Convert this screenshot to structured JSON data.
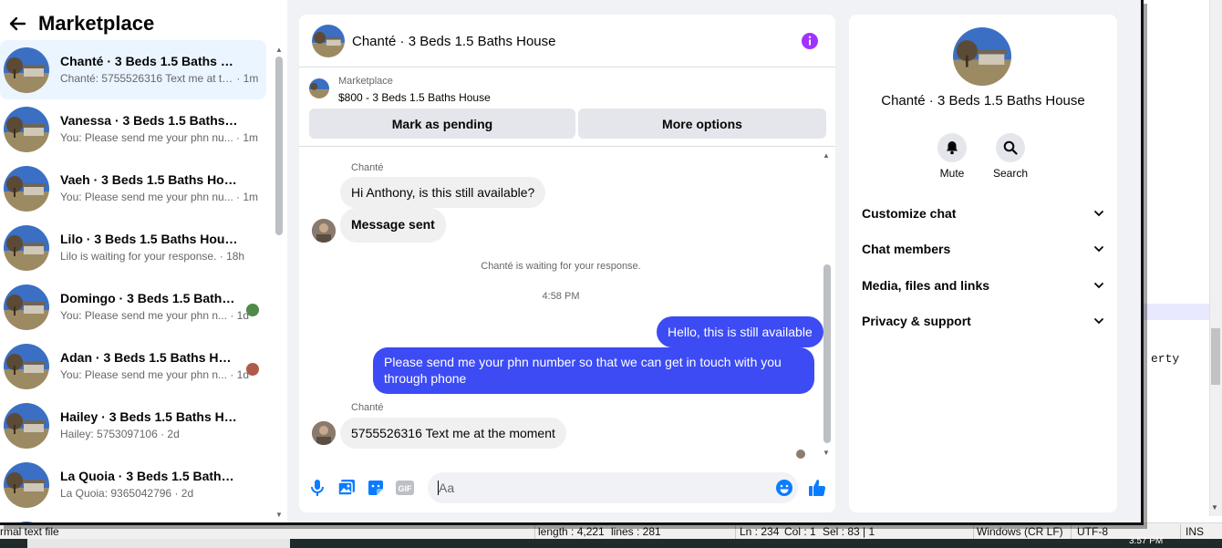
{
  "sidebar": {
    "title": "Marketplace",
    "conversations": [
      {
        "name": "Chanté · 3 Beds 1.5 Baths House",
        "snippet": "Chanté: 5755526316 Text me at th...",
        "time": " · 1m"
      },
      {
        "name": "Vanessa · 3 Beds 1.5 Baths House",
        "snippet": "You: Please send me your phn nu...",
        "time": " · 1m"
      },
      {
        "name": "Vaeh · 3 Beds 1.5 Baths House",
        "snippet": "You: Please send me your phn nu...",
        "time": " · 1m"
      },
      {
        "name": "Lilo · 3 Beds 1.5 Baths House",
        "snippet": "Lilo is waiting for your response.",
        "time": " · 18h"
      },
      {
        "name": "Domingo · 3 Beds 1.5 Baths H...",
        "snippet": "You: Please send me your phn n...",
        "time": " · 1d"
      },
      {
        "name": "Adan · 3 Beds 1.5 Baths House",
        "snippet": "You: Please send me your phn n...",
        "time": " · 1d"
      },
      {
        "name": "Hailey · 3 Beds 1.5 Baths House",
        "snippet": "Hailey: 5753097106",
        "time": " · 2d"
      },
      {
        "name": "La Quoia · 3 Beds 1.5 Baths House",
        "snippet": "La Quoia: 9365042796",
        "time": " · 2d"
      }
    ]
  },
  "chat": {
    "title": "Chanté · 3 Beds 1.5 Baths House",
    "listing_source": "Marketplace",
    "listing_price": "$800 - 3 Beds 1.5 Baths House",
    "btn_pending": "Mark as pending",
    "btn_more": "More options",
    "sender_1": "Chanté",
    "msg_1": "Hi Anthony, is this still available?",
    "msg_2": "Message sent",
    "system_msg": "Chanté is waiting for your response.",
    "timestamp": "4:58 PM",
    "msg_3": "Hello, this is still available",
    "msg_4_line1": "Please send me your phn number so that we can get in touch with you",
    "msg_4_line2": "through phone",
    "sender_2": "Chanté",
    "msg_5": "5755526316 Text me at the moment",
    "input_placeholder": "Aa"
  },
  "details": {
    "title": "Chanté · 3 Beds 1.5 Baths House",
    "mute_label": "Mute",
    "search_label": "Search",
    "rows": [
      "Customize chat",
      "Chat members",
      "Media, files and links",
      "Privacy & support"
    ]
  },
  "editor": {
    "code_fragment": "erty",
    "status_left": "rmal text file",
    "status_length": "length : 4,221",
    "status_lines": "lines : 281",
    "status_ln": "Ln : 234",
    "status_col": "Col : 1",
    "status_sel": "Sel : 83 | 1",
    "status_eol": "Windows (CR LF)",
    "status_enc": "UTF-8",
    "status_ins": "INS",
    "clock": "3:57 PM"
  },
  "colors": {
    "accent": "#3c4bf4",
    "info": "#a033ff",
    "like": "#0a7cff",
    "active_row": "#ebf5ff"
  }
}
